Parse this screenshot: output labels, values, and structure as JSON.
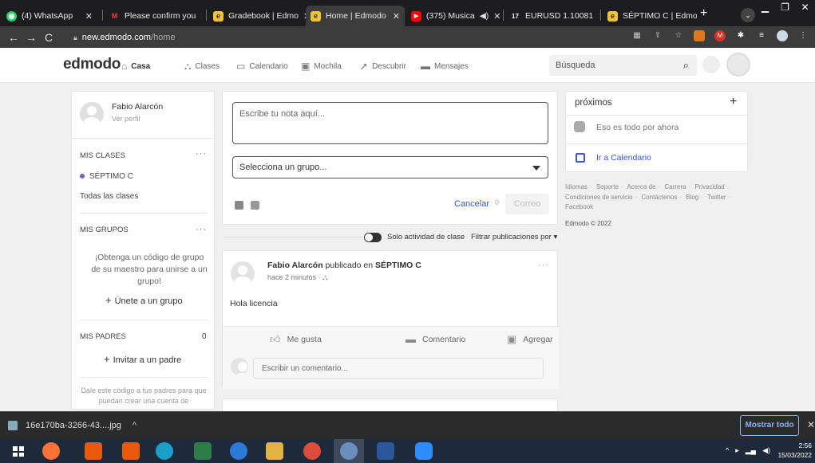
{
  "browser": {
    "tabs": [
      {
        "label": "(4) WhatsApp",
        "fav_color": "#25d366",
        "fav_glyph": "◉"
      },
      {
        "label": "Please confirm you",
        "fav_color": "#ea4335",
        "fav_glyph": "M"
      },
      {
        "label": "Gradebook | Edmo",
        "fav_color": "#f1c232",
        "fav_glyph": "e"
      },
      {
        "label": "Home | Edmodo",
        "fav_color": "#f1c232",
        "fav_glyph": "e"
      },
      {
        "label": "(375) Musica",
        "fav_color": "#ff0000",
        "fav_glyph": "▶"
      },
      {
        "label": "EURUSD 1.10081",
        "fav_color": "#1d1d1f",
        "fav_glyph": "17"
      },
      {
        "label": "SÉPTIMO C | Edmo",
        "fav_color": "#f1c232",
        "fav_glyph": "e"
      }
    ],
    "url_host": "new.edmodo.com",
    "url_path": "/home"
  },
  "header": {
    "logo": "edmodo",
    "nav": [
      {
        "label": "Casa",
        "icon": "home-icon"
      },
      {
        "label": "Clases",
        "icon": "classes-icon"
      },
      {
        "label": "Calendario",
        "icon": "calendar-icon"
      },
      {
        "label": "Mochila",
        "icon": "backpack-icon"
      },
      {
        "label": "Descubrir",
        "icon": "discover-icon"
      },
      {
        "label": "Mensajes",
        "icon": "messages-icon"
      }
    ],
    "search_placeholder": "Búsqueda"
  },
  "sidebar": {
    "user_name": "Fabio Alarcón",
    "view_profile": "Ver perfil",
    "my_classes": "MIS CLASES",
    "class_item": "SÉPTIMO C",
    "all_classes": "Todas las clases",
    "my_groups": "MIS GRUPOS",
    "groups_text": "¡Obtenga un código de grupo de su maestro para unirse a un grupo!",
    "join_group": "Únete a un grupo",
    "my_parents": "MIS PADRES",
    "parents_count": "0",
    "invite_parent": "Invitar a un padre",
    "parents_text": "Dale este código a tus padres para que puedan crear una cuenta de"
  },
  "composer": {
    "note_placeholder": "Escribe tu nota aquí...",
    "group_select": "Selecciona un grupo...",
    "cancel": "Cancelar",
    "counter": "0",
    "send": "Correo"
  },
  "filter": {
    "toggle_label": "Solo actividad de clase",
    "filter_label": "Filtrar publicaciones por ▾"
  },
  "post": {
    "author": "Fabio Alarcón",
    "published_in": "publicado en",
    "class": "SÉPTIMO C",
    "time": "hace 2 minutos ·",
    "body": "Hola licencia",
    "like": "Me gusta",
    "comment": "Comentario",
    "add": "Agregar",
    "comment_placeholder": "Escribir un comentario..."
  },
  "upcoming": {
    "title": "próximos",
    "empty": "Eso es todo por ahora",
    "go_calendar": "Ir a Calendario"
  },
  "footer": {
    "links": [
      "Idiomas",
      "Soporte",
      "Acerca de",
      "Carrera",
      "Privacidad",
      "Condiciones de servicio",
      "Contáctenos",
      "Blog",
      "Twitter",
      "Facebook"
    ],
    "copyright": "Edmodo © 2022"
  },
  "download_bar": {
    "file": "16e170ba-3266-43....jpg",
    "show_all": "Mostrar todo"
  },
  "taskbar": {
    "time": "2:56",
    "date": "15/03/2022"
  },
  "colors": {
    "accent": "#3b54d8",
    "brand_purple": "#7b5cd6"
  }
}
